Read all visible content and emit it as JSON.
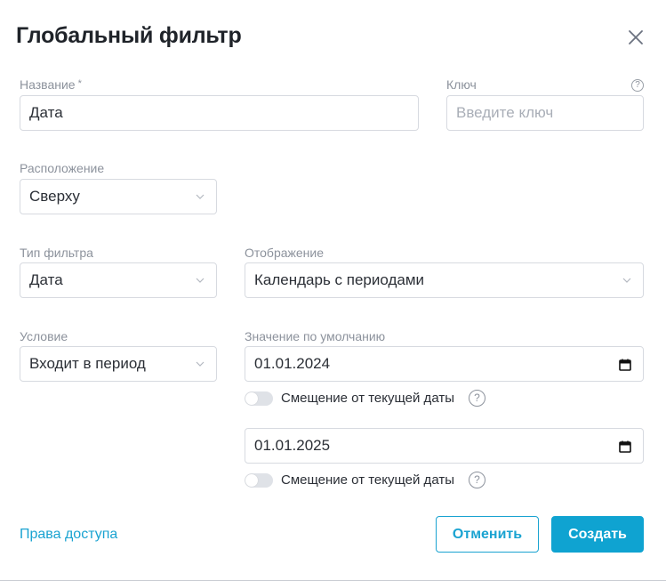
{
  "dialog": {
    "title": "Глобальный фильтр",
    "close_icon": "close-icon"
  },
  "fields": {
    "name": {
      "label": "Название",
      "required_mark": "*",
      "value": "Дата"
    },
    "key": {
      "label": "Ключ",
      "placeholder": "Введите ключ",
      "help_icon": "?"
    },
    "position": {
      "label": "Расположение",
      "value": "Сверху"
    },
    "filter_type": {
      "label": "Тип фильтра",
      "value": "Дата"
    },
    "display": {
      "label": "Отображение",
      "value": "Календарь с периодами"
    },
    "condition": {
      "label": "Условие",
      "value": "Входит в период"
    },
    "default_value": {
      "label": "Значение по умолчанию",
      "date_from": "01.01.2024",
      "date_to": "01.01.2025",
      "offset_label": "Смещение от текущей даты",
      "offset_help": "?",
      "offset_from_enabled": false,
      "offset_to_enabled": false
    }
  },
  "footer": {
    "access_link": "Права доступа",
    "cancel_label": "Отменить",
    "create_label": "Создать"
  },
  "colors": {
    "accent": "#0fa3d1",
    "label": "#8c929c",
    "border": "#d7dae0"
  }
}
